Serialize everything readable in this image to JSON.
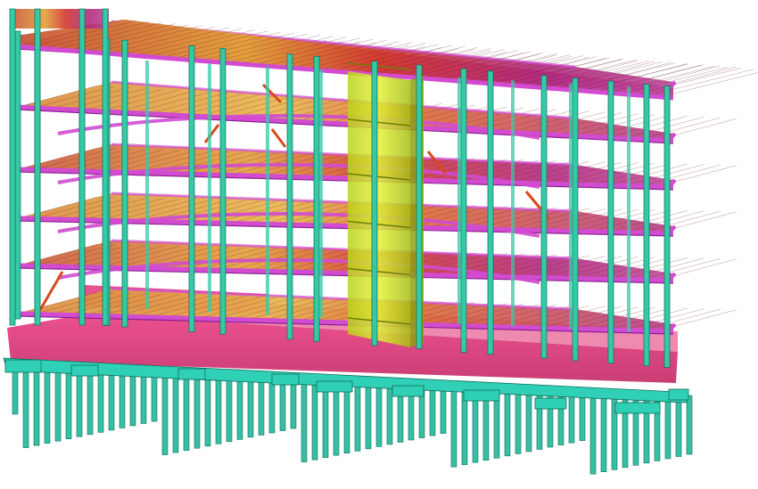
{
  "scene": {
    "kind": "3d-structural-model",
    "colors": {
      "background": "#ffffff",
      "column": "#35c9a6",
      "column_edge": "#0f6f5c",
      "beam": "#d24bd0",
      "beam_dark": "#8d1f93",
      "slab_warm": "#e9a13b",
      "slab_hot": "#d2262d",
      "slab_cool": "#a3238d",
      "core": "#d6ec1e",
      "basement": "#e0286f",
      "foundation": "#2fd0b5",
      "pile": "#36bfa3",
      "brace": "#d9481a"
    },
    "floors": 6,
    "has_core": true,
    "has_basement": true,
    "has_piles": true
  }
}
